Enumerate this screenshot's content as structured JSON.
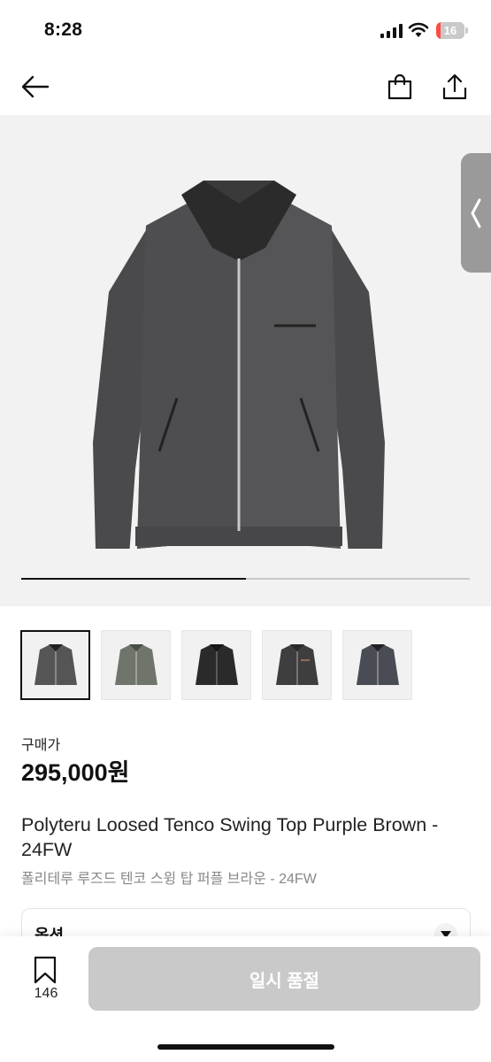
{
  "status": {
    "time": "8:28",
    "battery": "16",
    "battery_level": 0.16
  },
  "nav": {
    "back_icon": "arrow-left-icon",
    "bag_icon": "shopping-bag-icon",
    "share_icon": "share-icon"
  },
  "gallery": {
    "progress": 0.5,
    "thumbnail_count": 5,
    "selected_index": 0
  },
  "product": {
    "price_label": "구매가",
    "price": "295,000원",
    "title_en": "Polyteru Loosed Tenco Swing Top Purple Brown - 24FW",
    "title_ko": "폴리테루 루즈드 텐코 스윙 탑 퍼플 브라운 - 24FW"
  },
  "options": {
    "label": "옵션"
  },
  "bottom": {
    "wish_count": "146",
    "action_label": "일시 품절"
  },
  "colors": {
    "accent": "#111111",
    "disabled_button": "#c9c9c9",
    "battery_red": "#ff4d46"
  }
}
